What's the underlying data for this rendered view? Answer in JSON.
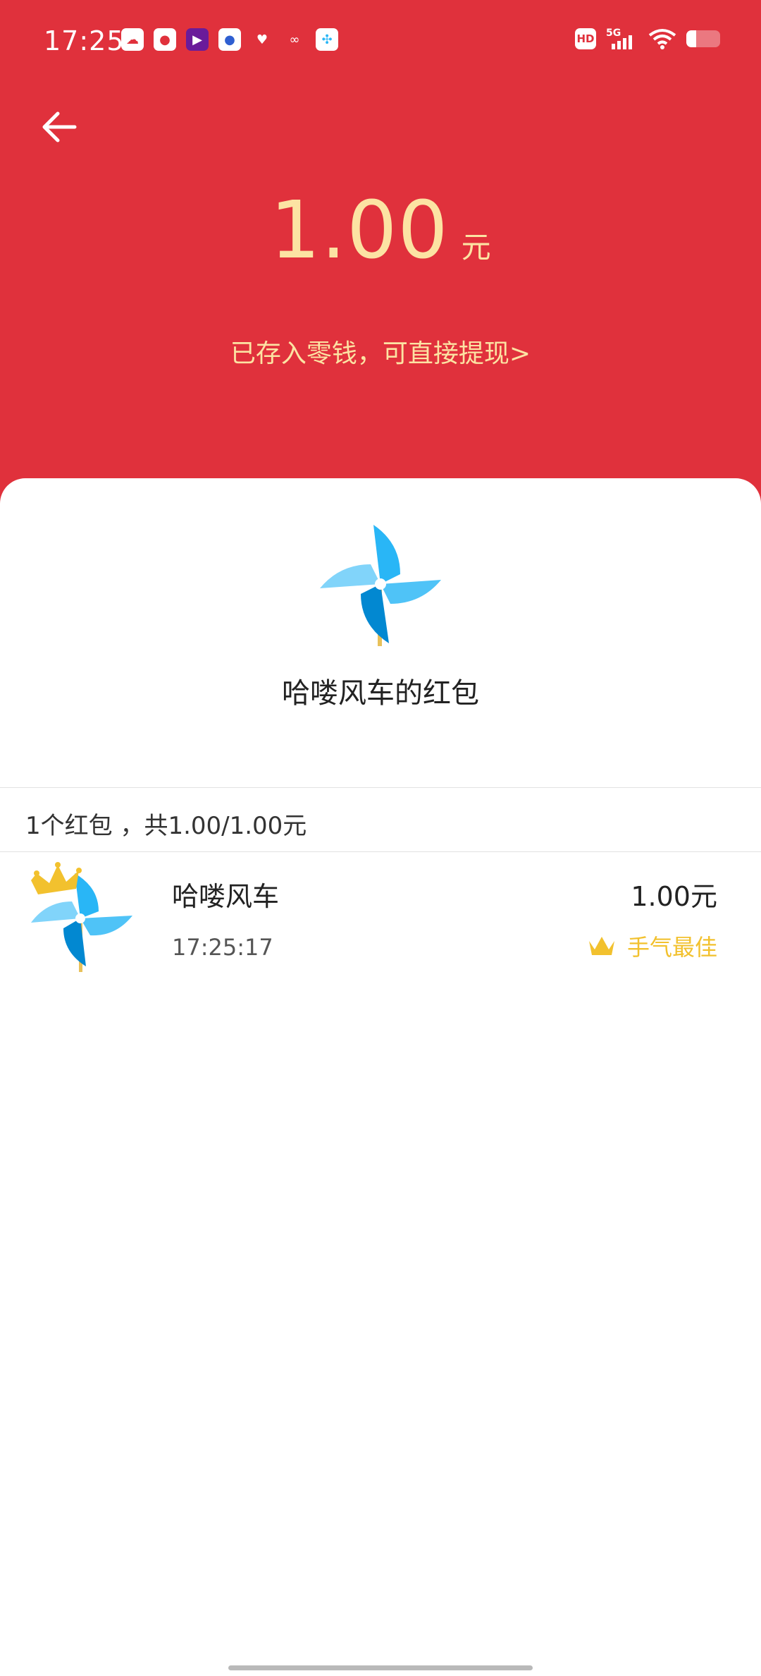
{
  "status_bar": {
    "time": "17:25",
    "notification_icons": [
      "baidu-netdisk-icon",
      "cat-app-icon",
      "video-app-icon",
      "baidu-icon",
      "heart-app-icon",
      "dots-app-icon",
      "pinwheel-app-icon"
    ],
    "hd": "HD",
    "network": "5G",
    "battery_percent": 30
  },
  "header": {
    "amount": "1.00",
    "unit": "元",
    "withdraw_text": "已存入零钱，可直接提现>"
  },
  "envelope": {
    "title": "哈喽风车的红包",
    "summary": "1个红包 ，共1.00/1.00元"
  },
  "records": [
    {
      "name": "哈喽风车",
      "time": "17:25:17",
      "amount": "1.00元",
      "badge": "手气最佳"
    }
  ],
  "colors": {
    "header_bg": "#E0313C",
    "gold_text": "#FCE3A3",
    "crown": "#F2C12E",
    "pinwheel": "#29B6F6"
  }
}
